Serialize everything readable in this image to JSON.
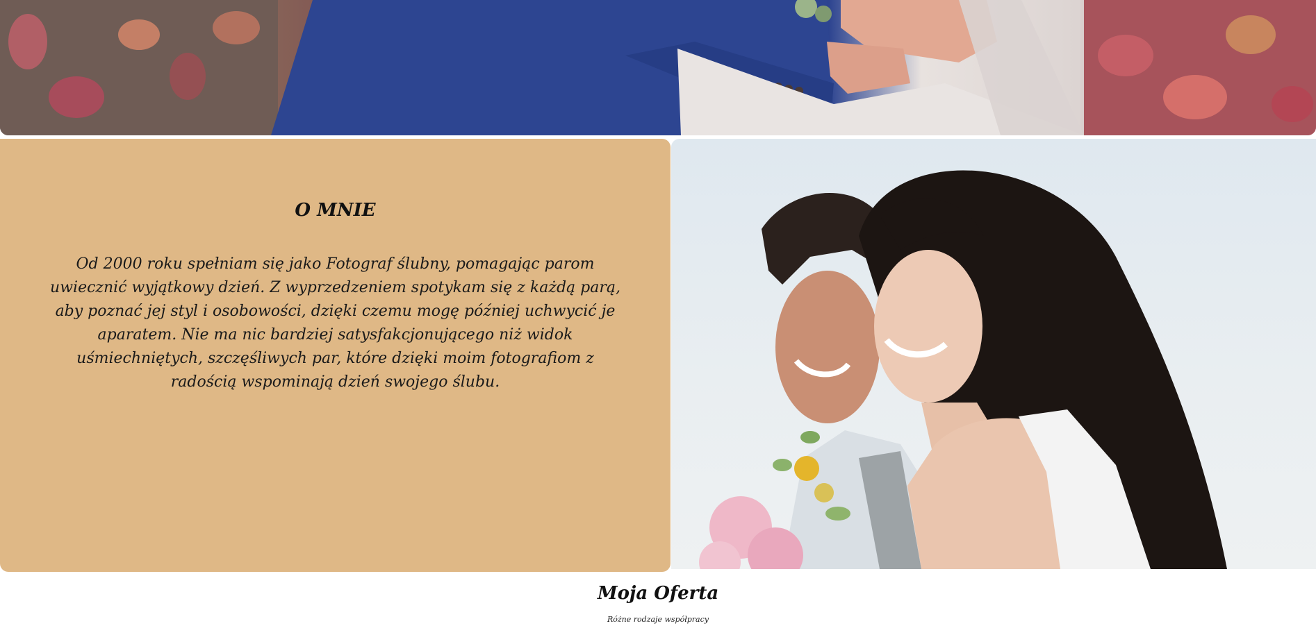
{
  "about": {
    "title": "O MNIE",
    "text": "Od 2000 roku spełniam się jako Fotograf ślubny, pomagając parom uwiecznić wyjątkowy dzień. Z wyprzedzeniem spotykam się z każdą parą, aby poznać jej styl i osobowości, dzięki czemu mogę później uchwycić je aparatem. Nie ma nic bardziej satysfakcjonującego niż widok uśmiechniętych, szczęśliwych par, które dzięki moim fotografiom z radością wspominają dzień swojego ślubu."
  },
  "offer": {
    "title": "Moja Oferta",
    "subtitle": "Różne rodzaje współpracy"
  },
  "colors": {
    "about_background": "#dfb886",
    "page_background": "#ffffff"
  }
}
